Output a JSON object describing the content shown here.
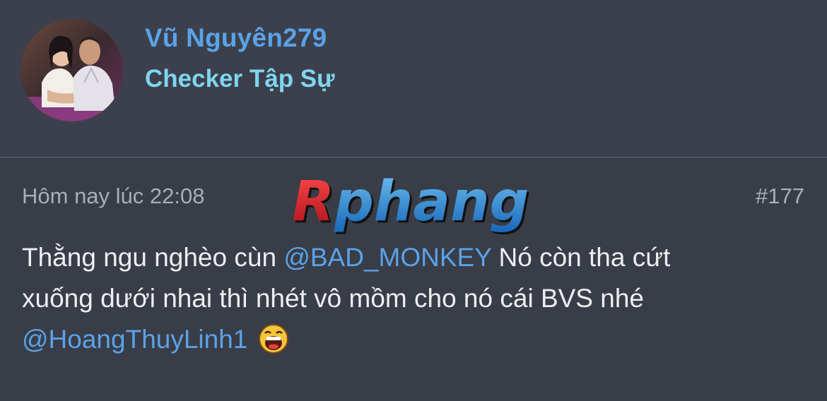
{
  "user": {
    "name": "Vũ Nguyên279",
    "title": "Checker Tập Sự"
  },
  "post": {
    "timestamp": "Hôm nay lúc 22:08",
    "number": "#177",
    "watermark": "Rphang",
    "content": {
      "line1_text": "Thằng ngu nghèo cùn ",
      "line1_mention": "@BAD_MONKEY",
      "line1_after": " Nó còn tha cứt",
      "line2_text": "xuống dưới nhai thì nhét vô mồm cho nó cái BVS nhé",
      "line3_mention": "@HoangThuyLinh1"
    },
    "smiley_icon": "laughing-smiley-icon"
  },
  "colors": {
    "background": "#3a3e49",
    "username": "#5aa2e8",
    "user_title": "#7fd5ef",
    "mention": "#5aa2e8",
    "text": "#eceef1",
    "muted": "#a9adb6"
  }
}
